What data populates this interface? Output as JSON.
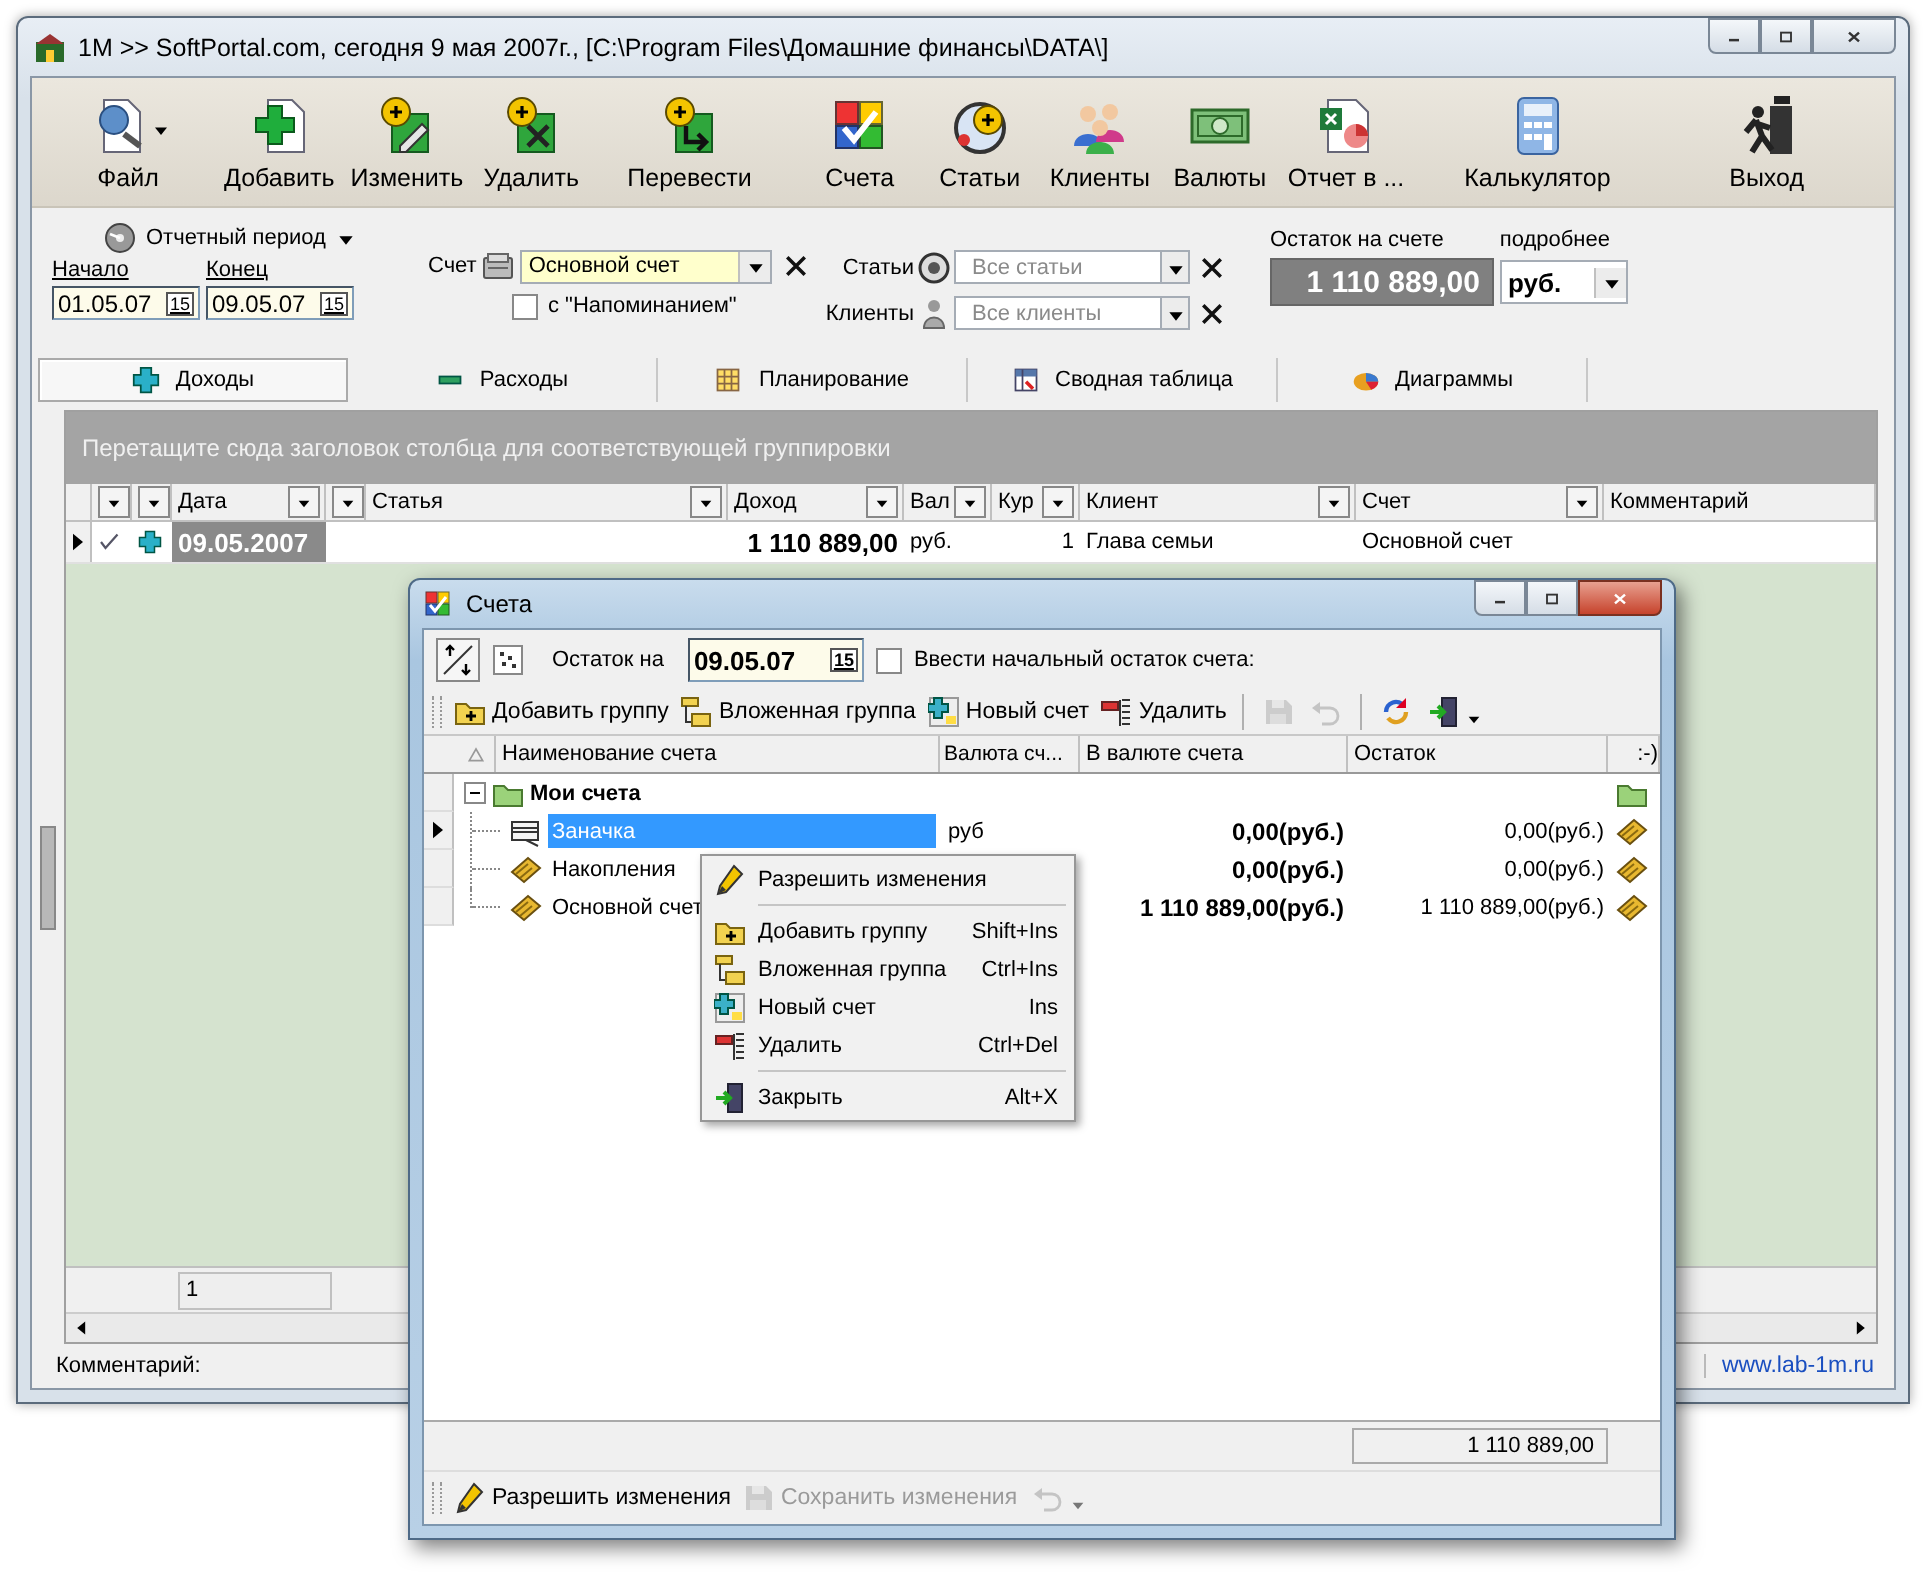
{
  "main_window": {
    "title": "1M >> SoftPortal.com, сегодня 9 мая 2007г., [C:\\Program Files\\Домашние финансы\\DATA\\]",
    "toolbar": [
      [
        {
          "label": "Файл",
          "dropdown": true
        }
      ],
      [
        {
          "label": "Добавить"
        },
        {
          "label": "Изменить"
        },
        {
          "label": "Удалить"
        }
      ],
      [
        {
          "label": "Перевести"
        }
      ],
      [
        {
          "label": "Счета"
        },
        {
          "label": "Статьи"
        },
        {
          "label": "Клиенты"
        },
        {
          "label": "Валюты"
        },
        {
          "label": "Отчет в ..."
        }
      ],
      [
        {
          "label": "Калькулятор"
        }
      ],
      [
        {
          "label": "Выход"
        }
      ]
    ],
    "period": {
      "label": "Отчетный период",
      "start_label": "Начало",
      "start": "01.05.07",
      "start_button": "15",
      "end_label": "Конец",
      "end": "09.05.07",
      "end_button": "15"
    },
    "account_filter": {
      "label": "Счет",
      "value": "Основной счет"
    },
    "reminder": {
      "label": "с \"Напоминанием\"",
      "checked": false
    },
    "articles_filter": {
      "label": "Статьи",
      "placeholder": "Все статьи"
    },
    "clients_filter": {
      "label": "Клиенты",
      "placeholder": "Все клиенты"
    },
    "balance": {
      "label": "Остаток на счете",
      "value": "1 110 889,00",
      "detail_label": "подробнее",
      "currency": "руб."
    },
    "tabs": [
      {
        "label": "Доходы",
        "selected": true
      },
      {
        "label": "Расходы",
        "selected": false
      },
      {
        "label": "Планирование",
        "selected": false
      },
      {
        "label": "Сводная таблица",
        "selected": false
      },
      {
        "label": "Диаграммы",
        "selected": false
      }
    ],
    "group_hint": "Перетащите сюда заголовок столбца для соответствующей группировки",
    "grid": {
      "columns": [
        {
          "filter": true
        },
        {
          "filter": true
        },
        {
          "label": "Дата",
          "filter": true
        },
        {
          "filter": true
        },
        {
          "label": "Статья",
          "filter": true
        },
        {
          "label": "Доход",
          "filter": true
        },
        {
          "label": "Вал",
          "filter": true
        },
        {
          "label": "Кур",
          "filter": true
        },
        {
          "label": "Клиент",
          "filter": true
        },
        {
          "label": "Счет",
          "filter": true
        },
        {
          "label": "Комментарий",
          "filter": false
        }
      ],
      "rows": [
        {
          "current": true,
          "confirmed": true,
          "date": "09.05.2007",
          "amount": "1 110 889,00",
          "currency": "руб.",
          "rate": "1",
          "client": "Глава семьи",
          "account": "Основной счет"
        }
      ]
    },
    "footer_count": "1",
    "status": {
      "label": "Комментарий:",
      "link": "www.lab-1m.ru"
    }
  },
  "accounts_window": {
    "title": "Счета",
    "balance_label": "Остаток на",
    "balance_date": "09.05.07",
    "date_button": "15",
    "initial_balance": {
      "label": "Ввести начальный остаток счета:",
      "checked": false
    },
    "toolbar": [
      {
        "kind": "button",
        "label": "Добавить группу",
        "disabled": false
      },
      {
        "kind": "button",
        "label": "Вложенная группа",
        "disabled": false
      },
      {
        "kind": "button",
        "label": "Новый счет",
        "disabled": false
      },
      {
        "kind": "button",
        "label": "Удалить",
        "disabled": false
      },
      {
        "kind": "separator"
      },
      {
        "kind": "icon",
        "disabled": true
      },
      {
        "kind": "icon",
        "disabled": true
      },
      {
        "kind": "separator"
      },
      {
        "kind": "icon",
        "disabled": false
      },
      {
        "kind": "icon",
        "disabled": false,
        "dropdown": true
      }
    ],
    "tree": {
      "columns": [
        {
          "label": "Наименование счета"
        },
        {
          "label": "Валюта сч..."
        },
        {
          "label": "В валюте счета"
        },
        {
          "label": "Остаток"
        },
        {
          "label": ":-)"
        }
      ],
      "nodes": [
        {
          "name": "Мои счета",
          "expanded": true,
          "children": [
            {
              "name": "Заначка",
              "selected": true,
              "currency": "руб",
              "amount": "0,00(руб.)",
              "balance": "0,00(руб.)"
            },
            {
              "name": "Накопления",
              "selected": false,
              "amount": "0,00(руб.)",
              "balance": "0,00(руб.)"
            },
            {
              "name": "Основной счет",
              "selected": false,
              "amount": "1 110 889,00(руб.)",
              "balance": "1 110 889,00(руб.)"
            }
          ]
        }
      ]
    },
    "total": "1 110 889,00",
    "bottom_toolbar": [
      {
        "label": "Разрешить изменения",
        "disabled": false
      },
      {
        "label": "Сохранить изменения",
        "disabled": true
      },
      {
        "disabled": true,
        "dropdown": true
      }
    ]
  },
  "context_menu": [
    {
      "kind": "item",
      "label": "Разрешить изменения"
    },
    {
      "kind": "separator"
    },
    {
      "kind": "item",
      "label": "Добавить группу",
      "shortcut": "Shift+Ins"
    },
    {
      "kind": "item",
      "label": "Вложенная группа",
      "shortcut": "Ctrl+Ins"
    },
    {
      "kind": "item",
      "label": "Новый счет",
      "shortcut": "Ins"
    },
    {
      "kind": "item",
      "label": "Удалить",
      "shortcut": "Ctrl+Del"
    },
    {
      "kind": "separator"
    },
    {
      "kind": "item",
      "label": "Закрыть",
      "shortcut": "Alt+X"
    }
  ]
}
